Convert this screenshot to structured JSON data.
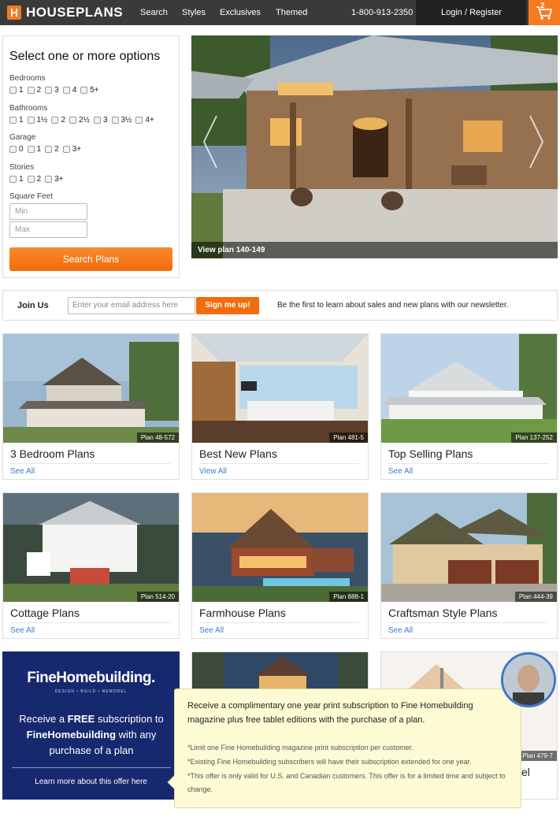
{
  "header": {
    "logo": "HOUSEPLANS",
    "nav": [
      "Search",
      "Styles",
      "Exclusives",
      "Themed"
    ],
    "phone": "1-800-913-2350",
    "login": "Login / Register",
    "cart_count": "2"
  },
  "search": {
    "title": "Select one or more options",
    "bedrooms_label": "Bedrooms",
    "bedrooms": [
      "1",
      "2",
      "3",
      "4",
      "5+"
    ],
    "bathrooms_label": "Bathrooms",
    "bathrooms": [
      "1",
      "1½",
      "2",
      "2½",
      "3",
      "3½",
      "4+"
    ],
    "garage_label": "Garage",
    "garage": [
      "0",
      "1",
      "2",
      "3+"
    ],
    "stories_label": "Stories",
    "stories": [
      "1",
      "2",
      "3+"
    ],
    "sqft_label": "Square Feet",
    "min_placeholder": "Min",
    "max_placeholder": "Max",
    "button": "Search Plans"
  },
  "hero": {
    "caption": "View plan 140-149"
  },
  "newsletter": {
    "join": "Join Us",
    "placeholder": "Enter your email address here",
    "button": "Sign me up!",
    "text": "Be the first to learn about sales and new plans with our newsletter."
  },
  "cards": [
    {
      "title": "3 Bedroom Plans",
      "link": "See All",
      "plan": "Plan 48-572"
    },
    {
      "title": "Best New Plans",
      "link": "View All",
      "plan": "Plan 481-5"
    },
    {
      "title": "Top Selling Plans",
      "link": "See All",
      "plan": "Plan 137-252"
    },
    {
      "title": "Cottage Plans",
      "link": "See All",
      "plan": "Plan 514-20"
    },
    {
      "title": "Farmhouse Plans",
      "link": "See All",
      "plan": "Plan 888-1"
    },
    {
      "title": "Craftsman Style Plans",
      "link": "See All",
      "plan": "Plan 444-39"
    }
  ],
  "partial_card": {
    "title_fragment": "el",
    "plan": "Plan 479-7"
  },
  "ad": {
    "logo": "FineHomebuilding.",
    "tagline": "DESIGN • BUILD • REMODEL",
    "copy_1": "Receive a ",
    "copy_bold_1": "FREE",
    "copy_2": " subscription to ",
    "copy_bold_2": "FineHomebuilding",
    "copy_3": " with any purchase of a plan",
    "link": "Learn more about this offer here"
  },
  "popup": {
    "main": "Receive a complimentary one year print subscription to Fine Homebuilding magazine plus free tablet editions with the purchase of a plan.",
    "note_1": "*Limit one Fine Homebuilding magazine print subscription per customer.",
    "note_2": "*Existing Fine Homebuilding subscribers will have their subscription extended for one year.",
    "note_3": "*This offer is only valid for U.S. and Canadian customers. This offer is for a limited time and subject to change."
  },
  "colors": {
    "accent": "#f16c0c",
    "nav": "#3a3a3a",
    "link": "#3a7bd5",
    "ad_bg": "#17296e"
  }
}
